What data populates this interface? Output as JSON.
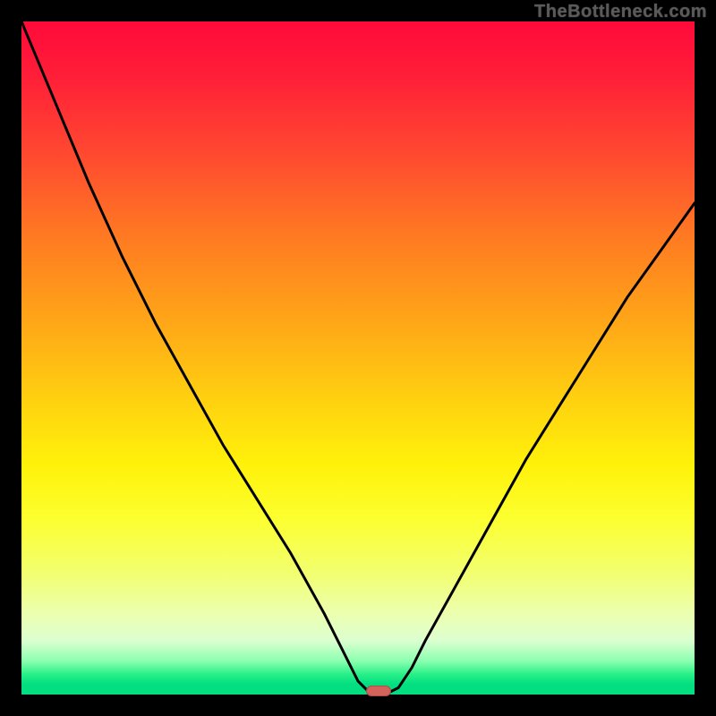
{
  "attribution": "TheBottleneck.com",
  "colors": {
    "curve": "#000000",
    "marker_fill": "#d2635c",
    "marker_border": "#b04a44"
  },
  "chart_data": {
    "type": "line",
    "title": "",
    "xlabel": "",
    "ylabel": "",
    "xlim": [
      0,
      100
    ],
    "ylim": [
      0,
      100
    ],
    "x": [
      0,
      5,
      10,
      15,
      20,
      25,
      30,
      35,
      40,
      45,
      48,
      50,
      52,
      54,
      56,
      58,
      60,
      65,
      70,
      75,
      80,
      85,
      90,
      95,
      100
    ],
    "values": [
      100,
      88,
      76,
      65,
      55,
      46,
      37,
      29,
      21,
      12,
      6,
      2,
      0,
      0,
      1,
      4,
      8,
      17,
      26,
      35,
      43,
      51,
      59,
      66,
      73
    ],
    "annotations": [
      {
        "type": "marker",
        "x": 53,
        "y": 0
      }
    ],
    "description": "V-shaped black curve on a vertical heat gradient background; minimum around x≈53 where a small rounded marker sits at the bottom edge."
  }
}
